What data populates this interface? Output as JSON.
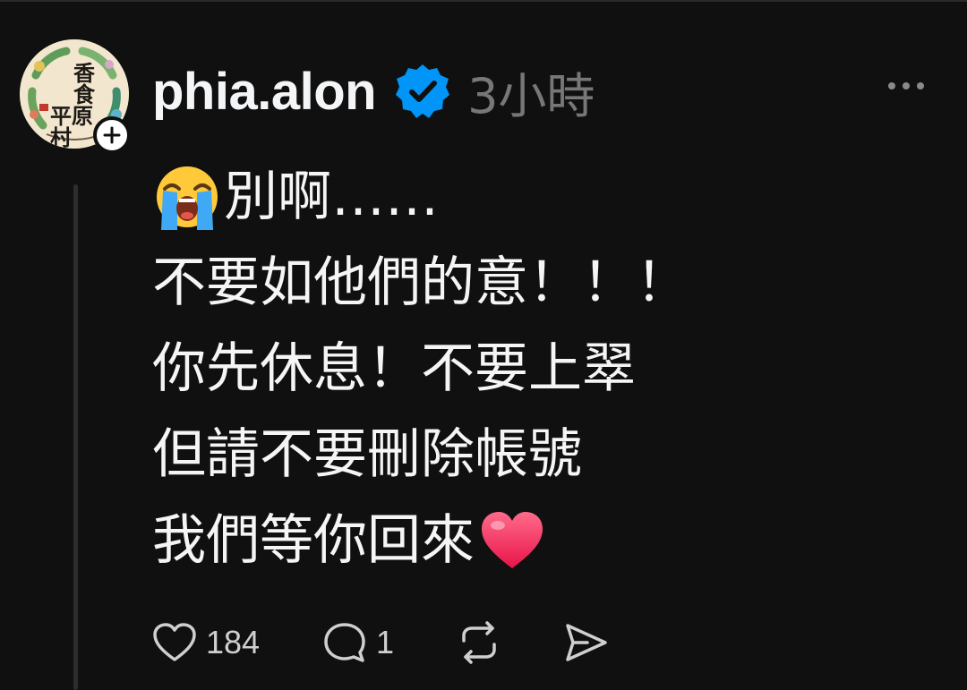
{
  "post": {
    "author": {
      "username": "phia.alon",
      "verified": true,
      "avatar_logo_text": [
        "香食",
        "平原村"
      ]
    },
    "timestamp": "3小時",
    "body_lines": [
      {
        "emoji_before": "loudly-crying-face",
        "text": "別啊……"
      },
      {
        "text": "不要如他們的意！！！"
      },
      {
        "text": "你先休息！不要上翠"
      },
      {
        "text": "但請不要刪除帳號"
      },
      {
        "text": "我們等你回來",
        "emoji_after": "red-heart"
      }
    ],
    "actions": {
      "like_count": "184",
      "reply_count": "1"
    }
  },
  "icons": {
    "more": "more-horizontal-icon",
    "like": "heart-outline-icon",
    "reply": "comment-bubble-icon",
    "repost": "repost-arrows-icon",
    "share": "send-paper-plane-icon",
    "verified": "verified-badge-icon",
    "follow": "plus-icon"
  },
  "colors": {
    "background": "#101010",
    "text": "#f3f5f7",
    "muted": "#777777",
    "verified_blue": "#0095f6",
    "heart_red": "#ff2d55"
  }
}
